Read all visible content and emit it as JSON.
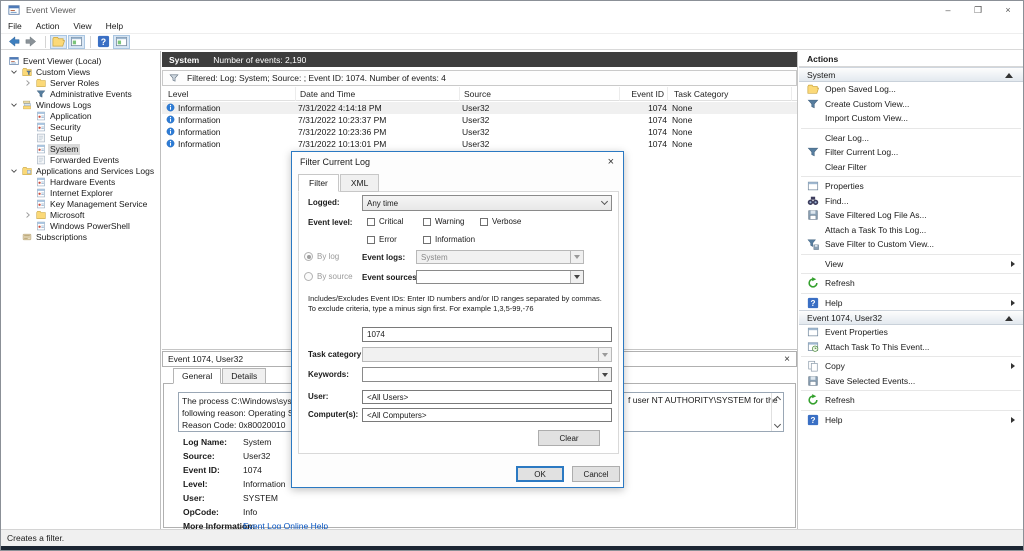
{
  "window": {
    "title": "Event Viewer",
    "controls": {
      "minimize": "–",
      "maximize": "❐",
      "close": "×"
    }
  },
  "menu": {
    "items": [
      "File",
      "Action",
      "View",
      "Help"
    ]
  },
  "toolbar": {
    "buttons": [
      {
        "name": "back-button",
        "icon": "back-arrow",
        "active": false
      },
      {
        "name": "forward-button",
        "icon": "forward-arrow",
        "active": false
      },
      {
        "name": "sep"
      },
      {
        "name": "open-saved-log-button",
        "icon": "folder-open",
        "active": true
      },
      {
        "name": "show-console-tree-button",
        "icon": "console-tree",
        "active": true
      },
      {
        "name": "sep"
      },
      {
        "name": "help-button",
        "icon": "help",
        "active": false
      },
      {
        "name": "show-action-pane-button",
        "icon": "console-tree",
        "active": true
      }
    ]
  },
  "tree": {
    "items": [
      {
        "label": "Event Viewer (Local)",
        "icon": "event-viewer-app",
        "level": 0,
        "expander": "none",
        "selected": false
      },
      {
        "label": "Custom Views",
        "icon": "folder-filter",
        "level": 1,
        "expander": "expanded",
        "selected": false
      },
      {
        "label": "Server Roles",
        "icon": "folder",
        "level": 2,
        "expander": "collapsed",
        "selected": false
      },
      {
        "label": "Administrative Events",
        "icon": "funnel",
        "level": 2,
        "expander": "none",
        "selected": false
      },
      {
        "label": "Windows Logs",
        "icon": "logs-stack",
        "level": 1,
        "expander": "expanded",
        "selected": false
      },
      {
        "label": "Application",
        "icon": "log",
        "level": 2,
        "expander": "none",
        "selected": false
      },
      {
        "label": "Security",
        "icon": "log",
        "level": 2,
        "expander": "none",
        "selected": false
      },
      {
        "label": "Setup",
        "icon": "log-plain",
        "level": 2,
        "expander": "none",
        "selected": false
      },
      {
        "label": "System",
        "icon": "log",
        "level": 2,
        "expander": "none",
        "selected": true
      },
      {
        "label": "Forwarded Events",
        "icon": "log-plain",
        "level": 2,
        "expander": "none",
        "selected": false
      },
      {
        "label": "Applications and Services Logs",
        "icon": "folder-apps",
        "level": 1,
        "expander": "expanded",
        "selected": false
      },
      {
        "label": "Hardware Events",
        "icon": "log",
        "level": 2,
        "expander": "none",
        "selected": false
      },
      {
        "label": "Internet Explorer",
        "icon": "log",
        "level": 2,
        "expander": "none",
        "selected": false
      },
      {
        "label": "Key Management Service",
        "icon": "log",
        "level": 2,
        "expander": "none",
        "selected": false
      },
      {
        "label": "Microsoft",
        "icon": "folder",
        "level": 2,
        "expander": "collapsed",
        "selected": false
      },
      {
        "label": "Windows PowerShell",
        "icon": "log",
        "level": 2,
        "expander": "none",
        "selected": false
      },
      {
        "label": "Subscriptions",
        "icon": "subscriptions",
        "level": 1,
        "expander": "none",
        "selected": false
      }
    ]
  },
  "main": {
    "log_header": {
      "title": "System",
      "count": "Number of events: 2,190"
    },
    "filter_bar": {
      "text": "Filtered: Log: System; Source: ; Event ID: 1074. Number of events: 4"
    },
    "table": {
      "columns": [
        "Level",
        "Date and Time",
        "Source",
        "Event ID",
        "Task Category"
      ],
      "rows": [
        {
          "level": "Information",
          "datetime": "7/31/2022 4:14:18 PM",
          "source": "User32",
          "event_id": "1074",
          "task_category": "None",
          "selected": true
        },
        {
          "level": "Information",
          "datetime": "7/31/2022 10:23:37 PM",
          "source": "User32",
          "event_id": "1074",
          "task_category": "None",
          "selected": false
        },
        {
          "level": "Information",
          "datetime": "7/31/2022 10:23:36 PM",
          "source": "User32",
          "event_id": "1074",
          "task_category": "None",
          "selected": false
        },
        {
          "level": "Information",
          "datetime": "7/31/2022 10:13:01 PM",
          "source": "User32",
          "event_id": "1074",
          "task_category": "None",
          "selected": false
        }
      ]
    },
    "detail": {
      "header": "Event 1074, User32",
      "tabs": [
        "General",
        "Details"
      ],
      "message": {
        "left_line1": "The process C:\\Windows\\system3",
        "left_line2": "following reason: Operating Syster",
        "left_line3": "Reason Code: 0x80020010",
        "right_line1": "f user NT AUTHORITY\\SYSTEM for the"
      },
      "properties": [
        {
          "label": "Log Name:",
          "value": "System",
          "link": false
        },
        {
          "label": "Source:",
          "value": "User32",
          "link": false
        },
        {
          "label": "Event ID:",
          "value": "1074",
          "link": false
        },
        {
          "label": "Level:",
          "value": "Information",
          "link": false
        },
        {
          "label": "User:",
          "value": "SYSTEM",
          "link": false
        },
        {
          "label": "OpCode:",
          "value": "Info",
          "link": false
        },
        {
          "label": "More Information:",
          "value": "Event Log Online Help",
          "link": true
        }
      ]
    }
  },
  "actions": {
    "title": "Actions",
    "sections": [
      {
        "header": "System",
        "items": [
          {
            "label": "Open Saved Log...",
            "icon": "folder-open",
            "arrow": false,
            "sep_before": false
          },
          {
            "label": "Create Custom View...",
            "icon": "funnel",
            "arrow": false,
            "sep_before": false
          },
          {
            "label": "Import Custom View...",
            "icon": "",
            "arrow": false,
            "sep_before": false
          },
          {
            "label": "Clear Log...",
            "icon": "",
            "arrow": false,
            "sep_before": true
          },
          {
            "label": "Filter Current Log...",
            "icon": "funnel",
            "arrow": false,
            "sep_before": false
          },
          {
            "label": "Clear Filter",
            "icon": "",
            "arrow": false,
            "sep_before": false
          },
          {
            "label": "Properties",
            "icon": "window-props",
            "arrow": false,
            "sep_before": true
          },
          {
            "label": "Find...",
            "icon": "find",
            "arrow": false,
            "sep_before": false
          },
          {
            "label": "Save Filtered Log File As...",
            "icon": "disk",
            "arrow": false,
            "sep_before": false
          },
          {
            "label": "Attach a Task To this Log...",
            "icon": "",
            "arrow": false,
            "sep_before": false
          },
          {
            "label": "Save Filter to Custom View...",
            "icon": "funnel-save",
            "arrow": false,
            "sep_before": false
          },
          {
            "label": "View",
            "icon": "",
            "arrow": true,
            "sep_before": true
          },
          {
            "label": "Refresh",
            "icon": "refresh",
            "arrow": false,
            "sep_before": true
          },
          {
            "label": "Help",
            "icon": "help",
            "arrow": true,
            "sep_before": true
          }
        ]
      },
      {
        "header": "Event 1074, User32",
        "items": [
          {
            "label": "Event Properties",
            "icon": "window-props",
            "arrow": false,
            "sep_before": false
          },
          {
            "label": "Attach Task To This Event...",
            "icon": "task",
            "arrow": false,
            "sep_before": false
          },
          {
            "label": "Copy",
            "icon": "copy",
            "arrow": true,
            "sep_before": true
          },
          {
            "label": "Save Selected Events...",
            "icon": "disk",
            "arrow": false,
            "sep_before": false
          },
          {
            "label": "Refresh",
            "icon": "refresh",
            "arrow": false,
            "sep_before": true
          },
          {
            "label": "Help",
            "icon": "help",
            "arrow": true,
            "sep_before": true
          }
        ]
      }
    ]
  },
  "dialog": {
    "title": "Filter Current Log",
    "close": "×",
    "tabs": [
      "Filter",
      "XML"
    ],
    "logged_label": "Logged:",
    "logged_value": "Any time",
    "event_level_label": "Event level:",
    "event_level_row1": [
      "Critical",
      "Warning",
      "Verbose"
    ],
    "event_level_row2": [
      "Error",
      "Information"
    ],
    "by_log_label": "By log",
    "event_logs_label": "Event logs:",
    "event_logs_value": "System",
    "by_source_label": "By source",
    "event_sources_label": "Event sources:",
    "event_sources_value": "",
    "ids_help": "Includes/Excludes Event IDs: Enter ID numbers and/or ID ranges separated by commas. To exclude criteria, type a minus sign first. For example 1,3,5-99,-76",
    "event_ids_value": "1074",
    "task_category_label": "Task category:",
    "task_category_value": "",
    "keywords_label": "Keywords:",
    "keywords_value": "",
    "user_label": "User:",
    "user_value": "<All Users>",
    "computers_label": "Computer(s):",
    "computers_value": "<All Computers>",
    "clear_label": "Clear",
    "ok_label": "OK",
    "cancel_label": "Cancel"
  },
  "statusbar": {
    "text": "Creates a filter."
  },
  "colors": {
    "accent_blue": "#2b79c2",
    "header_dark": "#3d3d3d",
    "link_blue": "#0a57c2",
    "info_icon_blue": "#2e7cd6",
    "selection_gray": "#d9d9d9"
  }
}
